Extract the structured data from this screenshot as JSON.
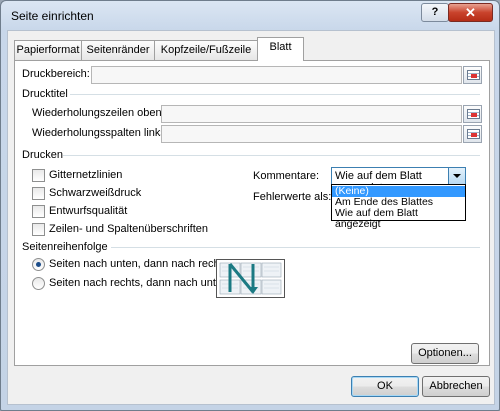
{
  "window": {
    "title": "Seite einrichten",
    "help_label": "?",
    "close_label": "✕"
  },
  "tabs": [
    {
      "label": "Papierformat"
    },
    {
      "label": "Seitenränder"
    },
    {
      "label": "Kopfzeile/Fußzeile"
    },
    {
      "label": "Blatt"
    }
  ],
  "druckbereich": {
    "label": "Druckbereich:",
    "value": ""
  },
  "drucktitel": {
    "heading": "Drucktitel",
    "zeilen_label": "Wiederholungszeilen oben:",
    "spalten_label": "Wiederholungsspalten links:"
  },
  "drucken": {
    "heading": "Drucken",
    "checkboxes": [
      {
        "label": "Gitternetzlinien",
        "checked": false
      },
      {
        "label": "Schwarzweißdruck",
        "checked": false
      },
      {
        "label": "Entwurfsqualität",
        "checked": false
      },
      {
        "label": "Zeilen- und Spaltenüberschriften",
        "checked": false
      }
    ],
    "kommentare_label": "Kommentare:",
    "kommentare_value": "Wie auf dem Blatt angezeigt",
    "fehlerwerte_label": "Fehlerwerte als:",
    "dropdown_options": [
      "(Keine)",
      "Am Ende des Blattes",
      "Wie auf dem Blatt angezeigt"
    ]
  },
  "seitenreihenfolge": {
    "heading": "Seitenreihenfolge",
    "options": [
      {
        "label": "Seiten nach unten, dann nach rechts",
        "checked": true
      },
      {
        "label": "Seiten nach rechts, dann nach unten",
        "checked": false
      }
    ]
  },
  "buttons": {
    "optionen": "Optionen...",
    "ok": "OK",
    "abbrechen": "Abbrechen"
  }
}
